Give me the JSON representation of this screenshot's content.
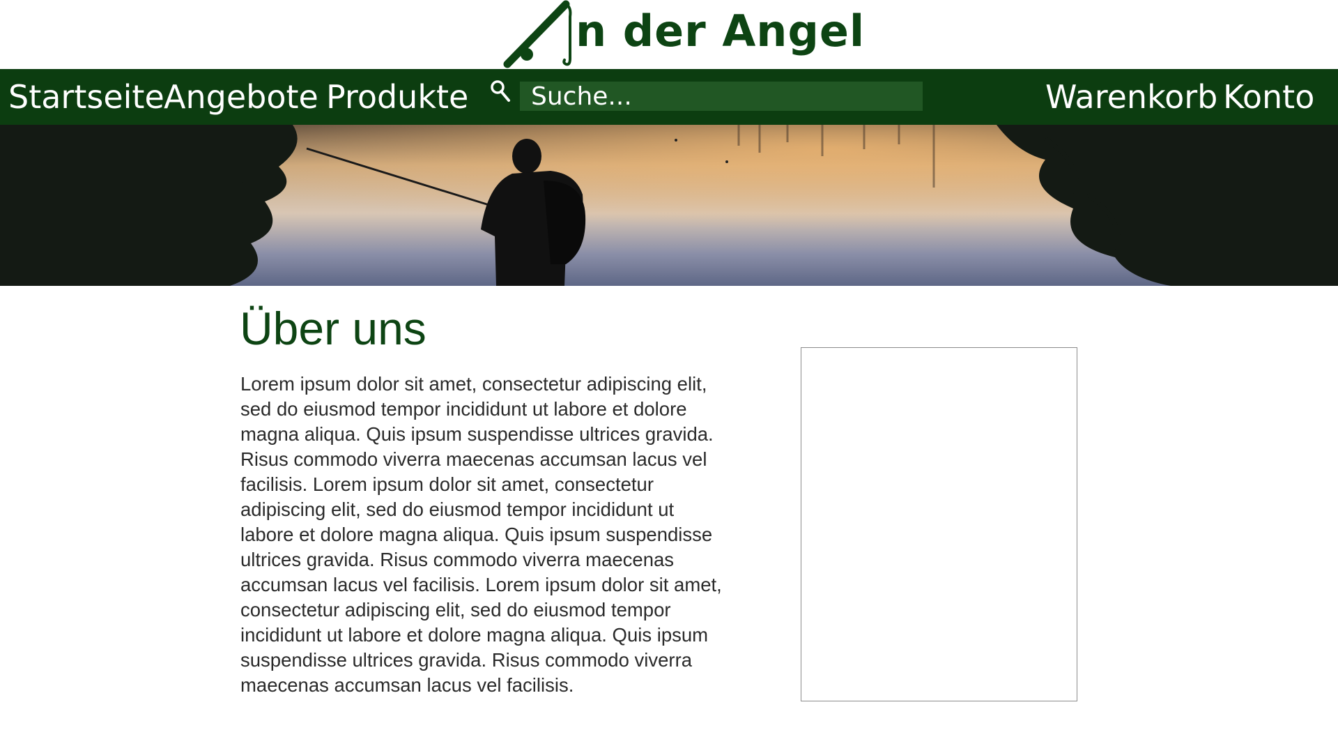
{
  "brand": {
    "name": "n der Angel",
    "color": "#0d4413"
  },
  "nav": {
    "items": [
      {
        "label": "Startseite"
      },
      {
        "label": "Angebote"
      },
      {
        "label": "Produkte"
      }
    ],
    "search": {
      "placeholder": "Suche...",
      "value": "",
      "icon": "search-icon"
    },
    "right_items": [
      {
        "label": "Warenkorb"
      },
      {
        "label": "Konto"
      }
    ],
    "background": "#0c3d10"
  },
  "hero": {
    "description_icon": "angler-sunset-banner"
  },
  "main": {
    "heading": "Über uns",
    "paragraph": "Lorem ipsum dolor sit amet, consectetur adipiscing elit, sed do eiusmod tempor incididunt ut labore et dolore magna aliqua. Quis ipsum suspendisse ultrices gravida. Risus commodo viverra maecenas accumsan lacus vel facilisis. Lorem ipsum dolor sit amet, consectetur adipiscing elit, sed do eiusmod tempor incididunt ut labore et dolore magna aliqua. Quis ipsum suspendisse ultrices gravida. Risus commodo viverra maecenas accumsan lacus vel facilisis. Lorem ipsum dolor sit amet, consectetur adipiscing elit, sed do eiusmod tempor incididunt ut labore et dolore magna aliqua. Quis ipsum suspendisse ultrices gravida. Risus commodo viverra maecenas accumsan lacus vel facilisis."
  }
}
